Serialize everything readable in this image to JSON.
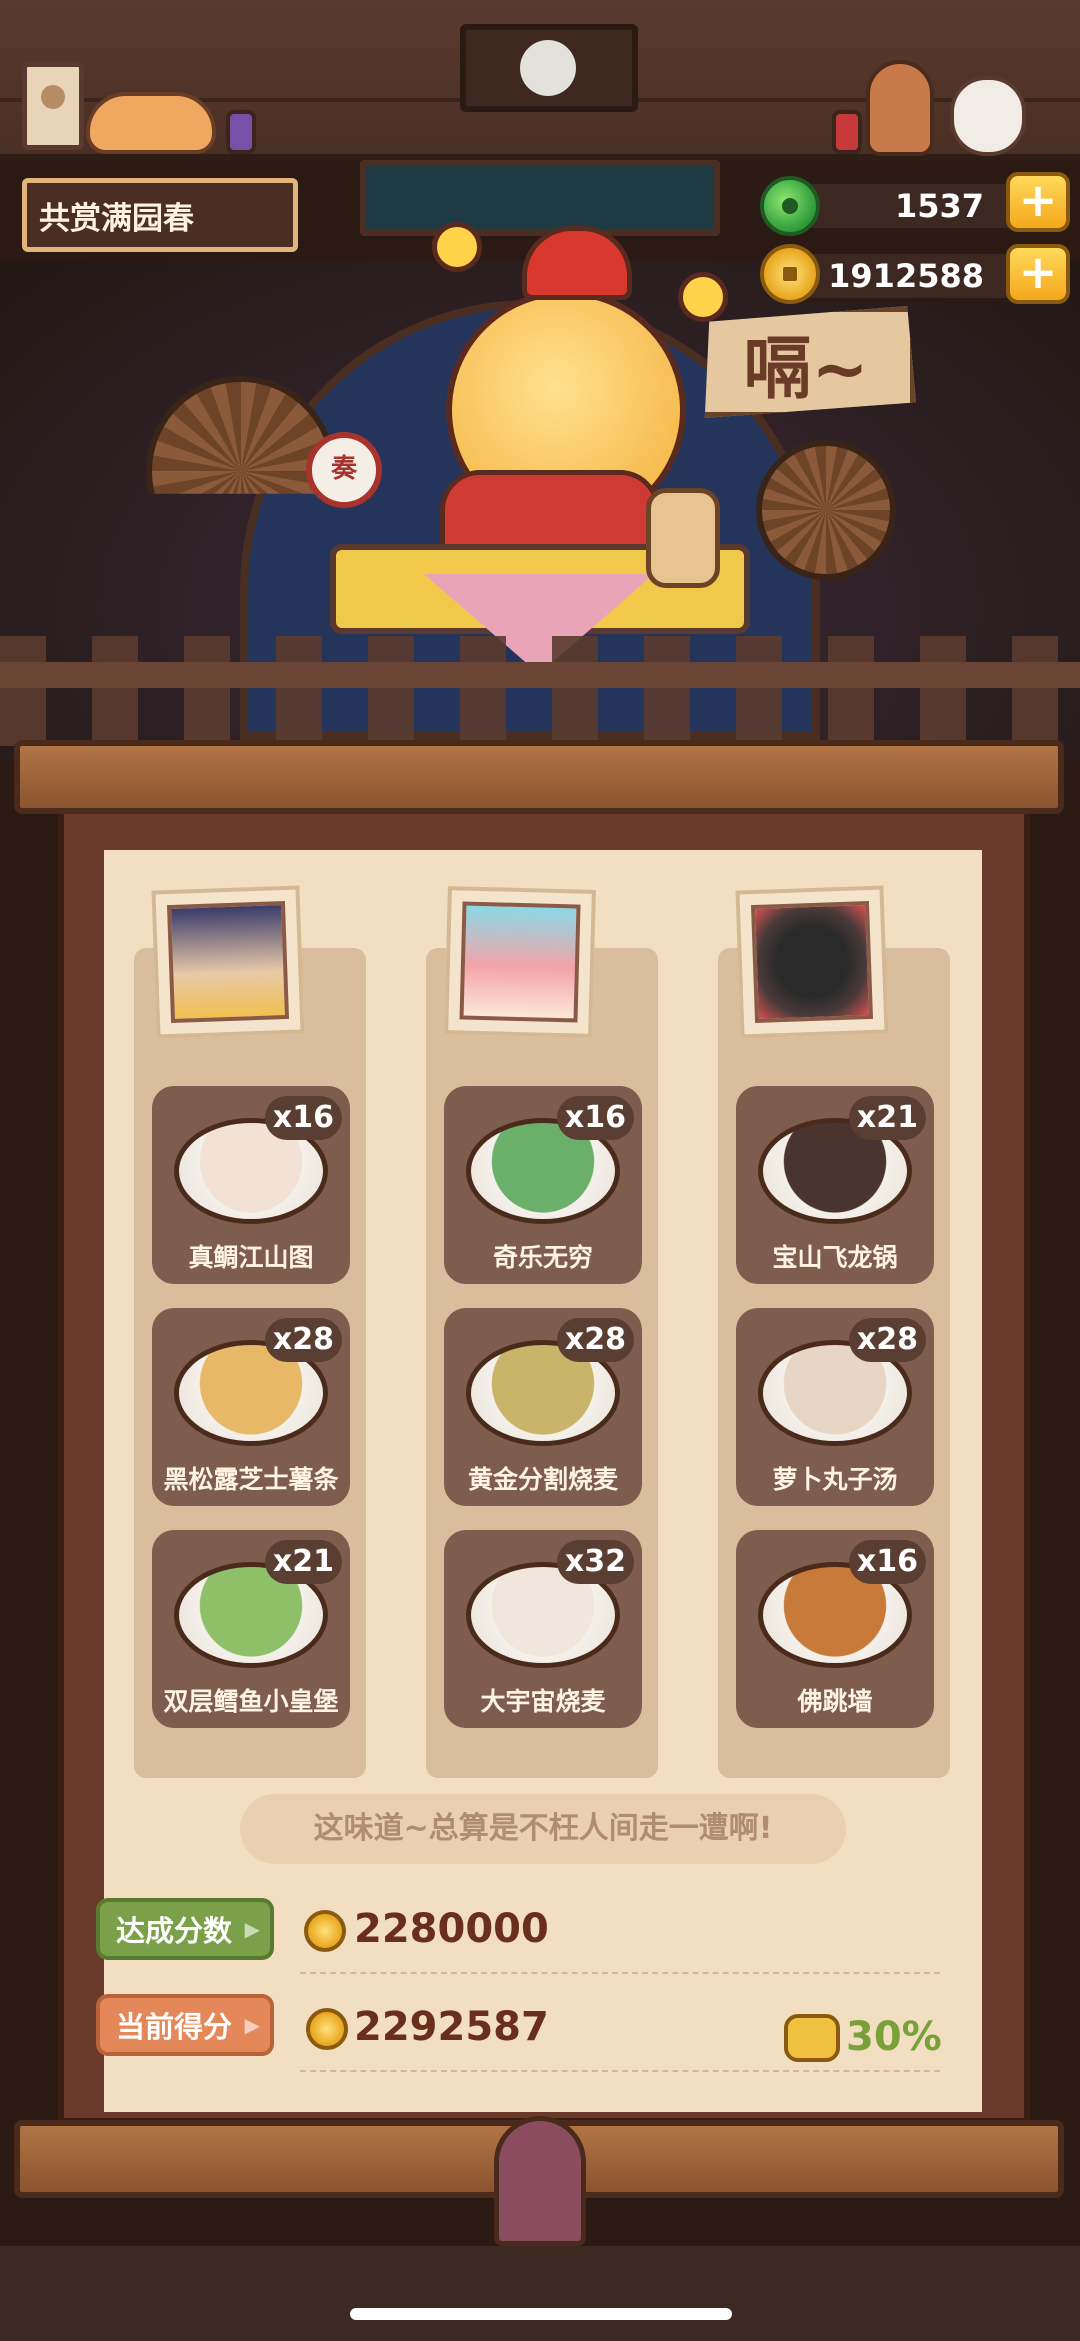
{
  "header": {
    "title": "共赏满园春"
  },
  "currency": {
    "jade": "1537",
    "coins": "1912588",
    "plus_label": "+"
  },
  "scene": {
    "drum_char": "奏",
    "speech": "嗝~"
  },
  "dishes": [
    [
      {
        "name": "真鲷江山图",
        "qty": "x16",
        "color": "#f2e2d6"
      },
      {
        "name": "黑松露芝士薯条",
        "qty": "x28",
        "color": "#e6b868"
      },
      {
        "name": "双层鳕鱼小皇堡",
        "qty": "x21",
        "color": "#8ec06a"
      }
    ],
    [
      {
        "name": "奇乐无穷",
        "qty": "x16",
        "color": "#6ab06a"
      },
      {
        "name": "黄金分割烧麦",
        "qty": "x28",
        "color": "#c9b46a"
      },
      {
        "name": "大宇宙烧麦",
        "qty": "x32",
        "color": "#f0e6dc"
      }
    ],
    [
      {
        "name": "宝山飞龙锅",
        "qty": "x21",
        "color": "#4a3430"
      },
      {
        "name": "萝卜丸子汤",
        "qty": "x28",
        "color": "#e8d6c4"
      },
      {
        "name": "佛跳墙",
        "qty": "x16",
        "color": "#c87a3a"
      }
    ]
  ],
  "saying": "这味道~总算是不枉人间走一遭啊!",
  "score": {
    "target_label": "达成分数",
    "target_value": "2280000",
    "current_label": "当前得分",
    "current_value": "2292587",
    "bonus": "30%"
  },
  "colors": {
    "accent_green": "#7aa04a",
    "accent_orange": "#e4885a",
    "score_text": "#6a2e1c"
  }
}
